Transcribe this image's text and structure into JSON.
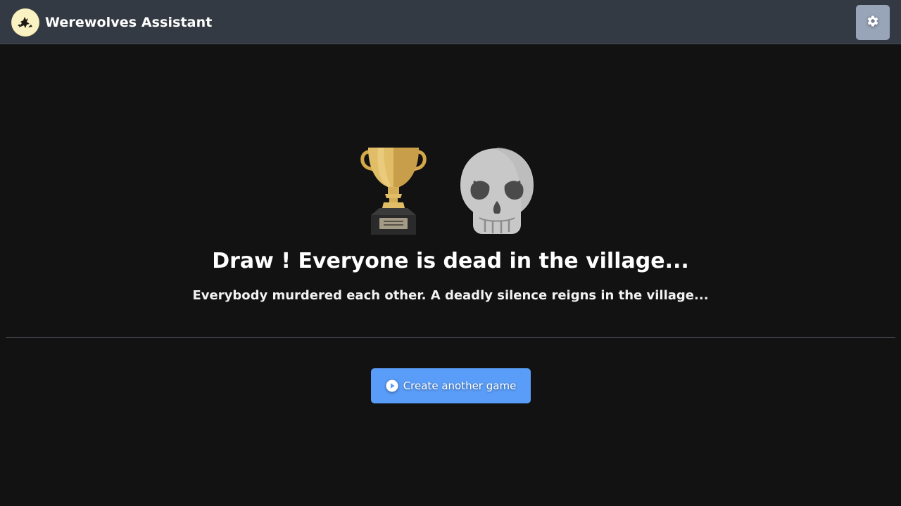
{
  "app": {
    "title": "Werewolves Assistant",
    "logo_icon": "werewolf-logo",
    "settings_icon": "gear-icon"
  },
  "result": {
    "trophy_icon": "trophy-icon",
    "outcome_icon": "skull-icon",
    "headline": "Draw ! Everyone is dead in the village...",
    "description": "Everybody murdered each other. A deadly silence reigns in the village..."
  },
  "actions": {
    "create_game_label": "Create another game",
    "create_game_icon": "play-circle-icon"
  },
  "colors": {
    "background": "#121212",
    "navbar": "#343a43",
    "settings_button": "#98a4b8",
    "primary_button": "#5a9df8"
  }
}
